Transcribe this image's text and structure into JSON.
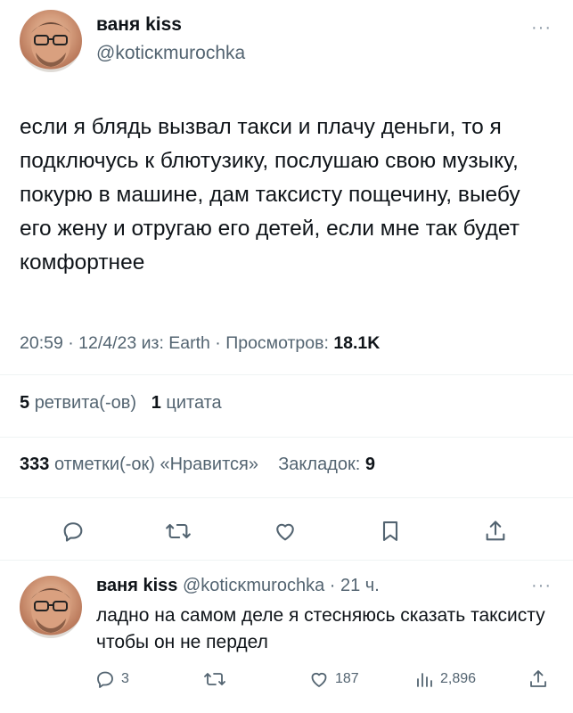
{
  "tweet": {
    "author_name": "ваня kiss",
    "author_handle": "@koticĸmurochka",
    "more_glyph": "···",
    "text": "если я блядь вызвал такси и плачу деньги, то я подключусь к блютузику, послушаю свою музыку, покурю в машине, дам таксисту пощечину, выебу его жену и отругаю его детей, если мне так будет комфортнее",
    "time_meta": "20:59 · 12/4/23 из: Earth · Просмотров:",
    "views": "18.1K",
    "retweets_count": "5",
    "retweets_label": "ретвита(-ов)",
    "quotes_count": "1",
    "quotes_label": "цитата",
    "likes_count": "333",
    "likes_label": "отметки(-ок) «Нравится»",
    "bookmarks_label": "Закладок:",
    "bookmarks_count": "9"
  },
  "reply": {
    "author_name": "ваня kiss",
    "author_handle": "@koticĸmurochka",
    "time": "· 21 ч.",
    "more_glyph": "···",
    "text": "ладно на самом деле я стесняюсь сказать таксисту чтобы он не пердел",
    "replies": "3",
    "retweets": "",
    "likes": "187",
    "views": "2,896"
  },
  "icons": [
    "reply-icon",
    "retweet-icon",
    "like-icon",
    "bookmark-icon",
    "share-icon",
    "views-icon"
  ],
  "colors": {
    "text": "#0f1419",
    "muted": "#536471",
    "divider": "#eff3f4"
  }
}
